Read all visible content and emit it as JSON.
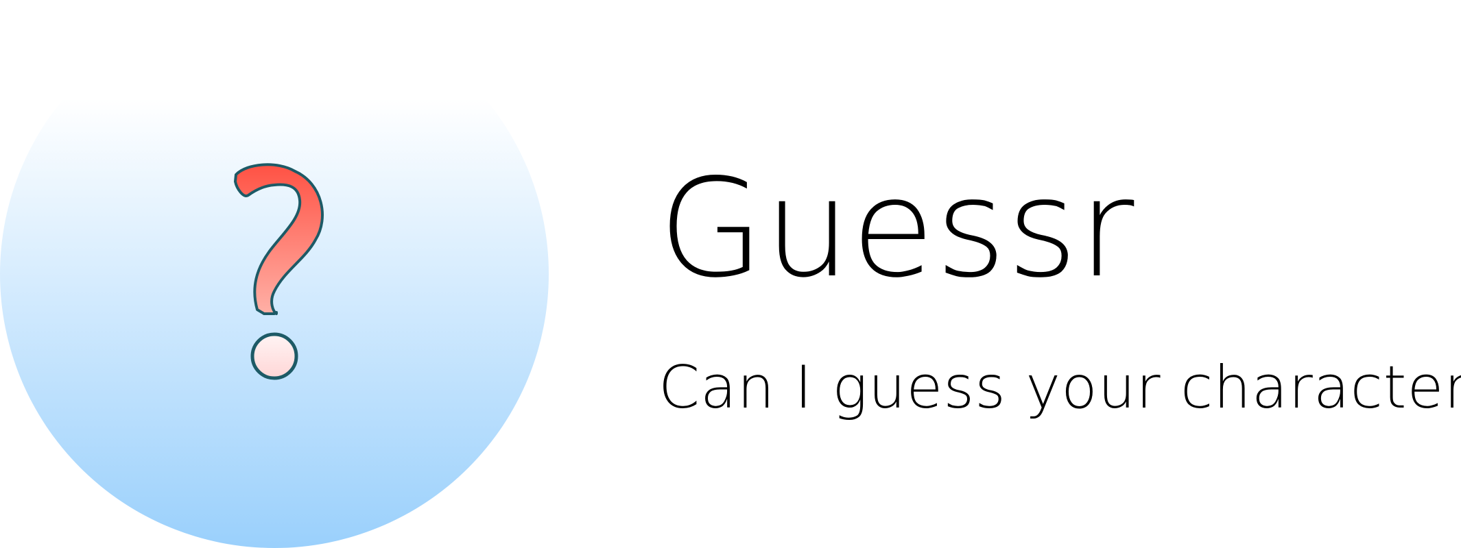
{
  "app": {
    "title": "Guessr",
    "tagline": "Can I guess your character?"
  },
  "logo": {
    "icon": "question-mark-icon",
    "circle_gradient_top": "#ffffff",
    "circle_gradient_bottom": "#9ad0fc",
    "mark_color_top": "#ff5244",
    "mark_color_bottom": "#ffe6e6",
    "outline_color": "#1d5a66"
  }
}
